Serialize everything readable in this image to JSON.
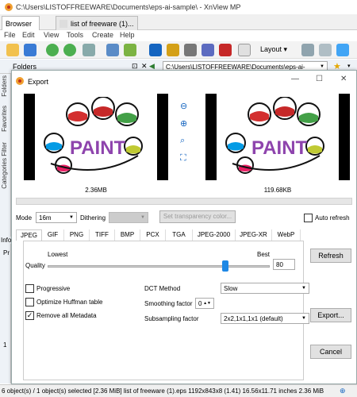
{
  "window": {
    "title": "C:\\Users\\LISTOFFREEWARE\\Documents\\eps-ai-sample\\ - XnView MP"
  },
  "tabs": [
    {
      "label": "Browser"
    },
    {
      "label": "list of freeware (1)..."
    }
  ],
  "menu": [
    "File",
    "Edit",
    "View",
    "Tools",
    "Create",
    "Help"
  ],
  "toolbar": {
    "layout_label": "Layout"
  },
  "panel": {
    "folders_label": "Folders",
    "address": "C:\\Users\\LISTOFFREEWARE\\Documents\\eps-ai-sample\\"
  },
  "sidetabs": [
    "Folders",
    "Favorites",
    "Categories Filter"
  ],
  "left_fragments": {
    "info": "Info",
    "p": "Pr",
    "one": "1"
  },
  "dialog": {
    "title": "Export",
    "original_size": "2.36MB",
    "preview_size": "119.68KB",
    "paint_text": "PAINT",
    "mode_label": "Mode",
    "mode_value": "16m",
    "dithering_label": "Dithering",
    "transparency_button": "Set transparency color...",
    "auto_refresh_label": "Auto refresh",
    "format_tabs": [
      "JPEG",
      "GIF",
      "PNG",
      "TIFF",
      "BMP",
      "PCX",
      "TGA",
      "JPEG-2000",
      "JPEG-XR",
      "WebP"
    ],
    "quality": {
      "label": "Quality",
      "lowest": "Lowest",
      "best": "Best",
      "value": "80"
    },
    "progressive_label": "Progressive",
    "huffman_label": "Optimize Huffman table",
    "metadata_label": "Remove all Metadata",
    "dct_label": "DCT Method",
    "dct_value": "Slow",
    "smoothing_label": "Smoothing factor",
    "smoothing_value": "0",
    "subsampling_label": "Subsampling factor",
    "subsampling_value": "2x2,1x1,1x1 (default)",
    "refresh_button": "Refresh",
    "export_button": "Export...",
    "cancel_button": "Cancel"
  },
  "status": "6 object(s) / 1 object(s) selected [2.36 MiB]  list of freeware (1).eps  1192x843x8 (1.41)  16.56x11.71 inches  2.36 MiB"
}
